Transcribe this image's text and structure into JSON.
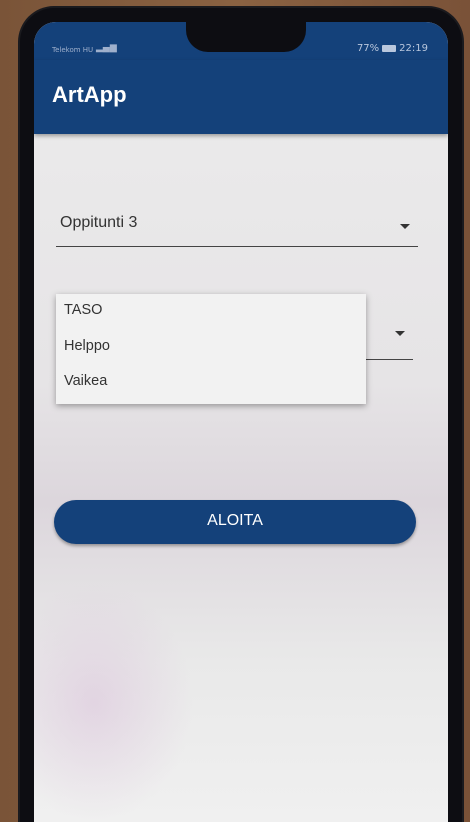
{
  "status_bar": {
    "carrier": "Telekom HU",
    "battery": "77%",
    "time": "22:19"
  },
  "app_bar": {
    "title": "ArtApp"
  },
  "lesson_dropdown": {
    "selected": "Oppitunti 3"
  },
  "level_menu": {
    "items": [
      {
        "label": "TASO"
      },
      {
        "label": "Helppo"
      },
      {
        "label": "Vaikea"
      }
    ]
  },
  "start_button": {
    "label": "ALOITA"
  },
  "colors": {
    "primary": "#14417a",
    "screen_bg": "#ececec",
    "text": "#333333"
  }
}
